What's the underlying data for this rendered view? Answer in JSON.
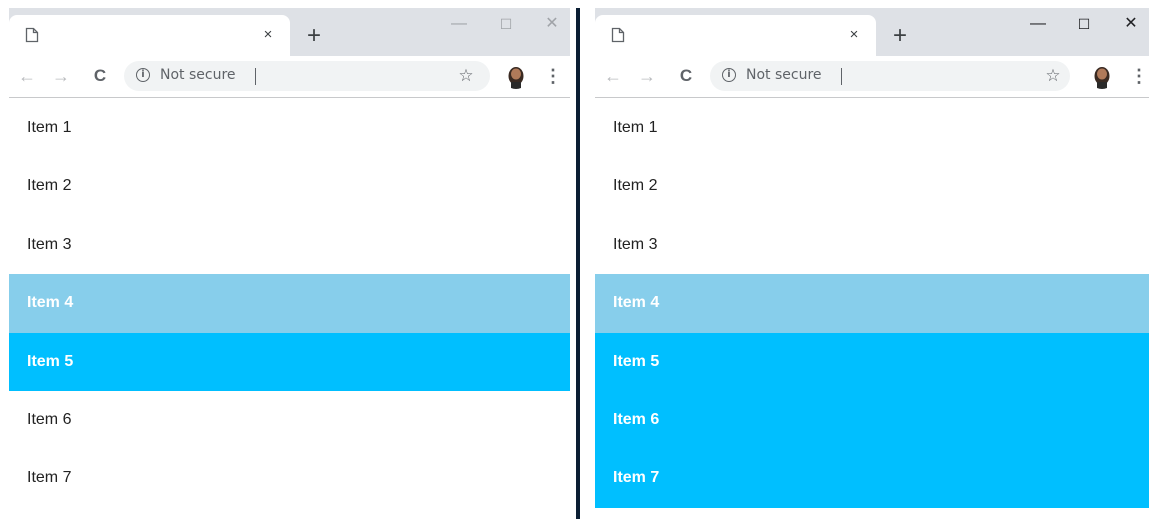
{
  "colors": {
    "hover_bg": "#87ceeb",
    "selected_bg": "#00bfff",
    "titlebar_bg": "#dee1e6",
    "omnibox_bg": "#f1f3f4"
  },
  "browser": {
    "new_tab_glyph": "+",
    "tab_close_glyph": "×",
    "minimize_glyph": "—",
    "maximize_glyph": "☐",
    "close_glyph": "✕",
    "back_glyph": "←",
    "forward_glyph": "→",
    "reload_glyph": "C",
    "info_glyph": "i",
    "security_label": "Not secure",
    "star_glyph": "☆",
    "menu_glyph": "⋮"
  },
  "windows": {
    "left": {
      "items": [
        {
          "label": "Item 1",
          "state": "normal"
        },
        {
          "label": "Item 2",
          "state": "normal"
        },
        {
          "label": "Item 3",
          "state": "normal"
        },
        {
          "label": "Item 4",
          "state": "hover"
        },
        {
          "label": "Item 5",
          "state": "selected"
        },
        {
          "label": "Item 6",
          "state": "normal"
        },
        {
          "label": "Item 7",
          "state": "normal"
        }
      ]
    },
    "right": {
      "items": [
        {
          "label": "Item 1",
          "state": "normal"
        },
        {
          "label": "Item 2",
          "state": "normal"
        },
        {
          "label": "Item 3",
          "state": "normal"
        },
        {
          "label": "Item 4",
          "state": "hover"
        },
        {
          "label": "Item 5",
          "state": "selected"
        },
        {
          "label": "Item 6",
          "state": "selected"
        },
        {
          "label": "Item 7",
          "state": "selected"
        }
      ]
    }
  }
}
